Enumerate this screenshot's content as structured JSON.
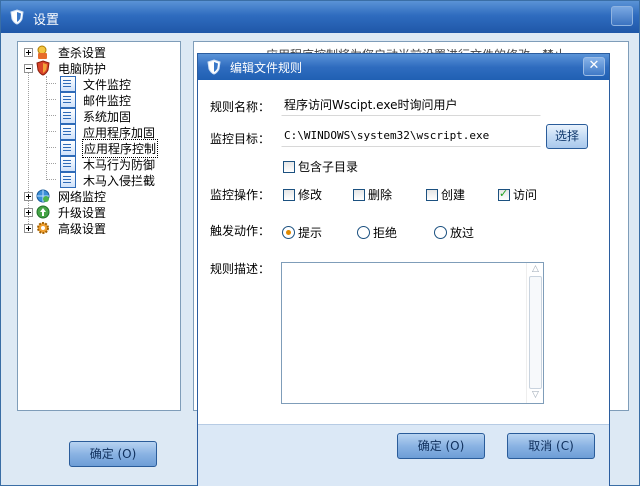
{
  "window": {
    "title": "设置",
    "shield_icon": "shield-icon"
  },
  "tree": {
    "items": [
      {
        "label": "查杀设置",
        "icon": "virus-scan-icon",
        "expander": "plus"
      },
      {
        "label": "电脑防护",
        "icon": "shield-icon",
        "expander": "minus"
      },
      {
        "label": "文件监控",
        "icon": "document-icon"
      },
      {
        "label": "邮件监控",
        "icon": "document-icon"
      },
      {
        "label": "系统加固",
        "icon": "document-icon"
      },
      {
        "label": "应用程序加固",
        "icon": "document-icon"
      },
      {
        "label": "应用程序控制",
        "icon": "document-icon",
        "selected": true
      },
      {
        "label": "木马行为防御",
        "icon": "document-icon"
      },
      {
        "label": "木马入侵拦截",
        "icon": "document-icon"
      },
      {
        "label": "网络监控",
        "icon": "network-icon",
        "expander": "plus"
      },
      {
        "label": "升级设置",
        "icon": "upgrade-icon",
        "expander": "plus"
      },
      {
        "label": "高级设置",
        "icon": "advanced-gear-icon",
        "expander": "plus"
      }
    ]
  },
  "background_panel": {
    "ghost_text": "应用程序控制将为您启动当前设置进行文件的修改、禁止"
  },
  "main_ok_label": "确定 (O)",
  "dialog": {
    "title": "编辑文件规则",
    "close_glyph": "✕",
    "rule_name_label": "规则名称：",
    "rule_name_value": "程序访问Wscipt.exe时询问用户",
    "target_label": "监控目标：",
    "target_value": "C:\\WINDOWS\\system32\\wscript.exe",
    "browse_label": "选择",
    "include_subdirs_label": "包含子目录",
    "ops_label": "监控操作：",
    "ops": [
      {
        "label": "修改",
        "checked": false
      },
      {
        "label": "删除",
        "checked": false
      },
      {
        "label": "创建",
        "checked": false
      },
      {
        "label": "访问",
        "checked": true
      }
    ],
    "action_label": "触发动作：",
    "actions": [
      {
        "label": "提示",
        "selected": true
      },
      {
        "label": "拒绝",
        "selected": false
      },
      {
        "label": "放过",
        "selected": false
      }
    ],
    "desc_label": "规则描述：",
    "desc_value": "",
    "ok_label": "确定 (O)",
    "cancel_label": "取消 (C)"
  },
  "colors": {
    "titlebar": "#2f6cbf",
    "accent": "#e08a00",
    "check": "#21a121"
  }
}
